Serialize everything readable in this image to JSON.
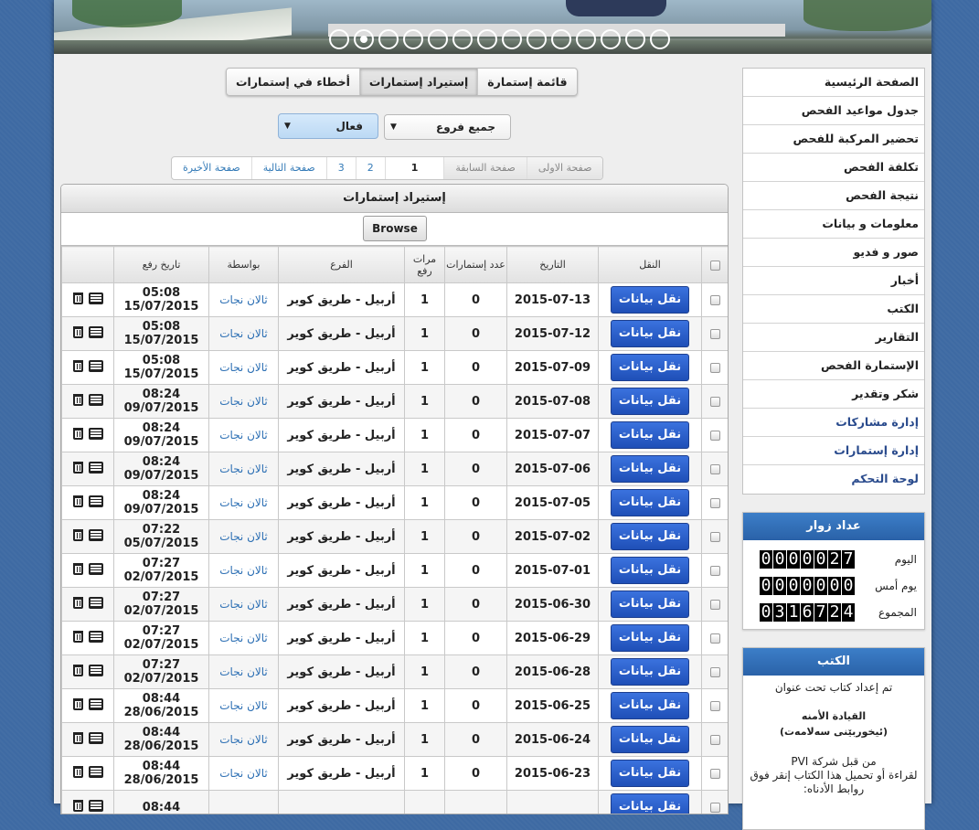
{
  "banner": {
    "slide_count": 14,
    "active_slide": 2
  },
  "tabs": [
    {
      "label": "قائمة إستمارة",
      "active": false
    },
    {
      "label": "إستيراد إستمارات",
      "active": true
    },
    {
      "label": "أخطاء في إستمارات",
      "active": false
    }
  ],
  "filters": {
    "branch": "جميع فروع",
    "status": "فعال"
  },
  "pagination": {
    "first": "صفحة الاولى",
    "prev": "صفحة السابقة",
    "pages": [
      "1",
      "2",
      "3"
    ],
    "current": "1",
    "next": "صفحة التالية",
    "last": "صفحة الأخيرة"
  },
  "panel": {
    "title": "إستيراد إستمارات",
    "browse_label": "Browse"
  },
  "table": {
    "headers": {
      "transfer": "النقل",
      "date": "التاريخ",
      "forms_count": "عدد إستمارات",
      "upload_times": "مرات رفع",
      "branch": "الفرع",
      "by": "بواسطة",
      "upload_date": "تاريخ رفع"
    },
    "transfer_label": "نقل بيانات",
    "rows": [
      {
        "date": "2015-07-13",
        "forms": "0",
        "uploads": "1",
        "branch": "أربيل - طريق كوير",
        "by": "ثالان نجات",
        "time": "05:08",
        "day": "15/07/2015"
      },
      {
        "date": "2015-07-12",
        "forms": "0",
        "uploads": "1",
        "branch": "أربيل - طريق كوير",
        "by": "ثالان نجات",
        "time": "05:08",
        "day": "15/07/2015"
      },
      {
        "date": "2015-07-09",
        "forms": "0",
        "uploads": "1",
        "branch": "أربيل - طريق كوير",
        "by": "ثالان نجات",
        "time": "05:08",
        "day": "15/07/2015"
      },
      {
        "date": "2015-07-08",
        "forms": "0",
        "uploads": "1",
        "branch": "أربيل - طريق كوير",
        "by": "ثالان نجات",
        "time": "08:24",
        "day": "09/07/2015"
      },
      {
        "date": "2015-07-07",
        "forms": "0",
        "uploads": "1",
        "branch": "أربيل - طريق كوير",
        "by": "ثالان نجات",
        "time": "08:24",
        "day": "09/07/2015"
      },
      {
        "date": "2015-07-06",
        "forms": "0",
        "uploads": "1",
        "branch": "أربيل - طريق كوير",
        "by": "ثالان نجات",
        "time": "08:24",
        "day": "09/07/2015"
      },
      {
        "date": "2015-07-05",
        "forms": "0",
        "uploads": "1",
        "branch": "أربيل - طريق كوير",
        "by": "ثالان نجات",
        "time": "08:24",
        "day": "09/07/2015"
      },
      {
        "date": "2015-07-02",
        "forms": "0",
        "uploads": "1",
        "branch": "أربيل - طريق كوير",
        "by": "ثالان نجات",
        "time": "07:22",
        "day": "05/07/2015"
      },
      {
        "date": "2015-07-01",
        "forms": "0",
        "uploads": "1",
        "branch": "أربيل - طريق كوير",
        "by": "ثالان نجات",
        "time": "07:27",
        "day": "02/07/2015"
      },
      {
        "date": "2015-06-30",
        "forms": "0",
        "uploads": "1",
        "branch": "أربيل - طريق كوير",
        "by": "ثالان نجات",
        "time": "07:27",
        "day": "02/07/2015"
      },
      {
        "date": "2015-06-29",
        "forms": "0",
        "uploads": "1",
        "branch": "أربيل - طريق كوير",
        "by": "ثالان نجات",
        "time": "07:27",
        "day": "02/07/2015"
      },
      {
        "date": "2015-06-28",
        "forms": "0",
        "uploads": "1",
        "branch": "أربيل - طريق كوير",
        "by": "ثالان نجات",
        "time": "07:27",
        "day": "02/07/2015"
      },
      {
        "date": "2015-06-25",
        "forms": "0",
        "uploads": "1",
        "branch": "أربيل - طريق كوير",
        "by": "ثالان نجات",
        "time": "08:44",
        "day": "28/06/2015"
      },
      {
        "date": "2015-06-24",
        "forms": "0",
        "uploads": "1",
        "branch": "أربيل - طريق كوير",
        "by": "ثالان نجات",
        "time": "08:44",
        "day": "28/06/2015"
      },
      {
        "date": "2015-06-23",
        "forms": "0",
        "uploads": "1",
        "branch": "أربيل - طريق كوير",
        "by": "ثالان نجات",
        "time": "08:44",
        "day": "28/06/2015"
      },
      {
        "date": "",
        "forms": "",
        "uploads": "",
        "branch": "",
        "by": "",
        "time": "08:44",
        "day": ""
      }
    ]
  },
  "sidebar": {
    "menu": [
      {
        "label": "الصفحة الرئيسية",
        "admin": false
      },
      {
        "label": "جدول مواعيد الفحص",
        "admin": false
      },
      {
        "label": "تحضير المركبة للفحص",
        "admin": false
      },
      {
        "label": "تكلفة الفحص",
        "admin": false
      },
      {
        "label": "نتيجة الفحص",
        "admin": false
      },
      {
        "label": "معلومات و بيانات",
        "admin": false
      },
      {
        "label": "صور و فديو",
        "admin": false
      },
      {
        "label": "أخبار",
        "admin": false
      },
      {
        "label": "الكتب",
        "admin": false
      },
      {
        "label": "التقارير",
        "admin": false
      },
      {
        "label": "الإستمارة الفحص",
        "admin": false
      },
      {
        "label": "شكر وتقدير",
        "admin": false
      },
      {
        "label": "إدارة مشاركات",
        "admin": true
      },
      {
        "label": "إدارة إستمارات",
        "admin": true
      },
      {
        "label": "لوحة التحكم",
        "admin": true
      }
    ],
    "visitors": {
      "title": "عداد زوار",
      "rows": [
        {
          "label": "اليوم",
          "value": "0000027"
        },
        {
          "label": "يوم أمس",
          "value": "0000000"
        },
        {
          "label": "المجموع",
          "value": "0316724"
        }
      ]
    },
    "books": {
      "title": "الكتب",
      "intro": "تم إعداد كتاب تحت عنوان",
      "book_title_1": "القيادة الأمنه",
      "book_title_2": "(ئيخوربێنی سەلامەت)",
      "by_line": "من قبل شركة PVI",
      "download_note": "لقراءة أو تحميل هذا الكتاب إنقر فوق روابط الأدناه:"
    }
  },
  "colors": {
    "background": "#3e6aa3",
    "accent_blue": "#2a62a8",
    "transfer_button": "#2456c4",
    "link": "#2c6fb4"
  }
}
